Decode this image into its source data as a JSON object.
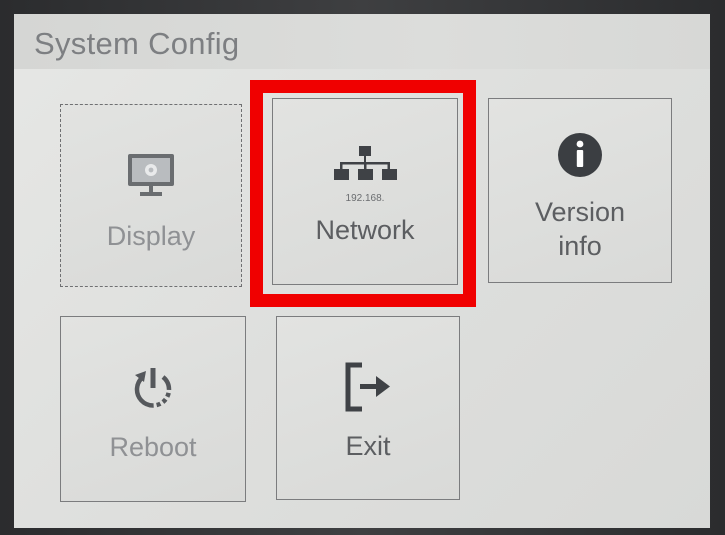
{
  "screen": {
    "title": "System Config"
  },
  "tiles": {
    "display": {
      "label": "Display",
      "icon": "monitor-gear-icon"
    },
    "network": {
      "label": "Network",
      "sublabel": "192.168.",
      "icon": "network-tree-icon"
    },
    "version": {
      "label_line1": "Version",
      "label_line2": "info",
      "icon": "info-icon"
    },
    "reboot": {
      "label": "Reboot",
      "icon": "power-restart-icon"
    },
    "exit": {
      "label": "Exit",
      "icon": "exit-door-icon"
    }
  },
  "annotation": {
    "highlight_color": "#f00000",
    "highlighted_tile": "network"
  }
}
